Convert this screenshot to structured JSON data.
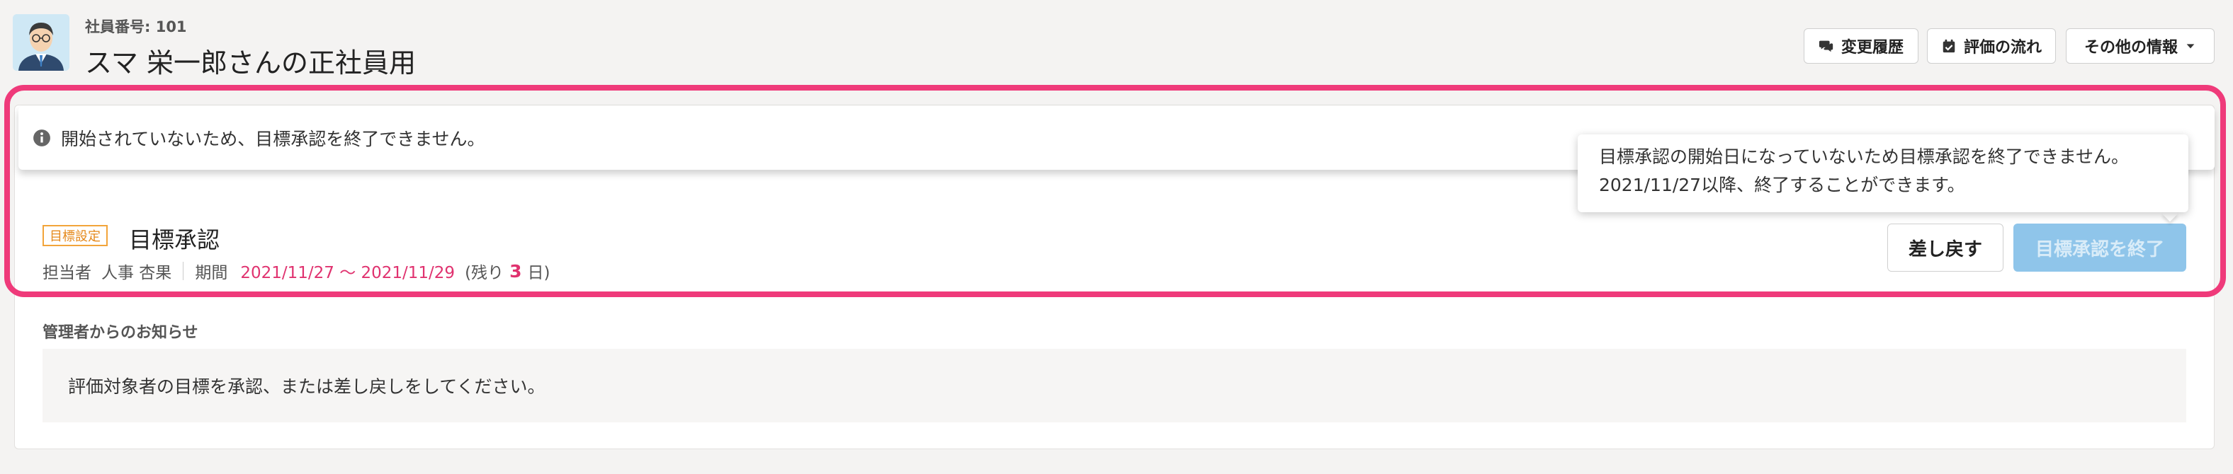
{
  "header": {
    "employee_number": "社員番号: 101",
    "title": "スマ 栄一郎さんの正社員用",
    "buttons": {
      "history": "変更履歴",
      "flow": "評価の流れ",
      "other": "その他の情報"
    }
  },
  "banner": {
    "message": "開始されていないため、目標承認を終了できません。"
  },
  "tooltip": {
    "line1": "目標承認の開始日になっていないため目標承認を終了できません。",
    "line2": "2021/11/27以降、終了することができます。"
  },
  "task": {
    "badge": "目標設定",
    "title": "目標承認",
    "assignee_label": "担当者",
    "assignee": "人事 杏果",
    "period_label": "期間",
    "period": "2021/11/27 〜 2021/11/29",
    "remaining_prefix": "(残り",
    "remaining_days": "3",
    "remaining_suffix": "日)",
    "return_button": "差し戻す",
    "finish_button": "目標承認を終了"
  },
  "notice": {
    "heading": "管理者からのお知らせ",
    "text": "評価対象者の目標を承認、または差し戻しをしてください。"
  },
  "colors": {
    "highlight": "#ef3a7a",
    "accent_pink": "#e0326f",
    "badge_orange": "#f2a43a",
    "finish_button": "#8fc5ea"
  }
}
